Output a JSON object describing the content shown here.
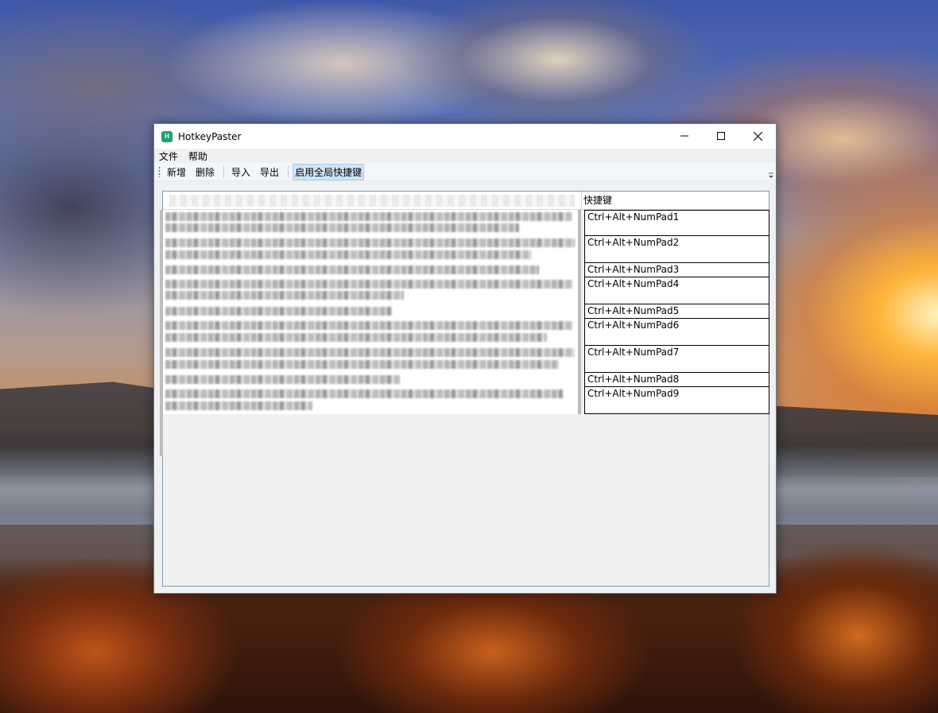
{
  "window": {
    "title": "HotkeyPaster",
    "icon_letter": "H",
    "controls": [
      "minimize-icon",
      "maximize-icon",
      "close-icon"
    ]
  },
  "menu": {
    "items": [
      {
        "label": "文件"
      },
      {
        "label": "帮助"
      }
    ]
  },
  "toolbar": {
    "add_label": "新增",
    "delete_label": "删除",
    "import_label": "导入",
    "export_label": "导出",
    "global_hotkey_label": "启用全局快捷键",
    "global_hotkey_checked": true
  },
  "grid": {
    "columns": {
      "hotkey_header": "快捷键"
    },
    "rows": [
      {
        "hotkey": "Ctrl+Alt+NumPad1"
      },
      {
        "hotkey": "Ctrl+Alt+NumPad2"
      },
      {
        "hotkey": "Ctrl+Alt+NumPad3"
      },
      {
        "hotkey": "Ctrl+Alt+NumPad4"
      },
      {
        "hotkey": "Ctrl+Alt+NumPad5"
      },
      {
        "hotkey": "Ctrl+Alt+NumPad6"
      },
      {
        "hotkey": "Ctrl+Alt+NumPad7"
      },
      {
        "hotkey": "Ctrl+Alt+NumPad8"
      },
      {
        "hotkey": "Ctrl+Alt+NumPad9"
      }
    ]
  },
  "colors": {
    "accent": "#1aa178",
    "toolbar_checked": "#cde4f7",
    "grid_border": "#7a9cb8"
  }
}
